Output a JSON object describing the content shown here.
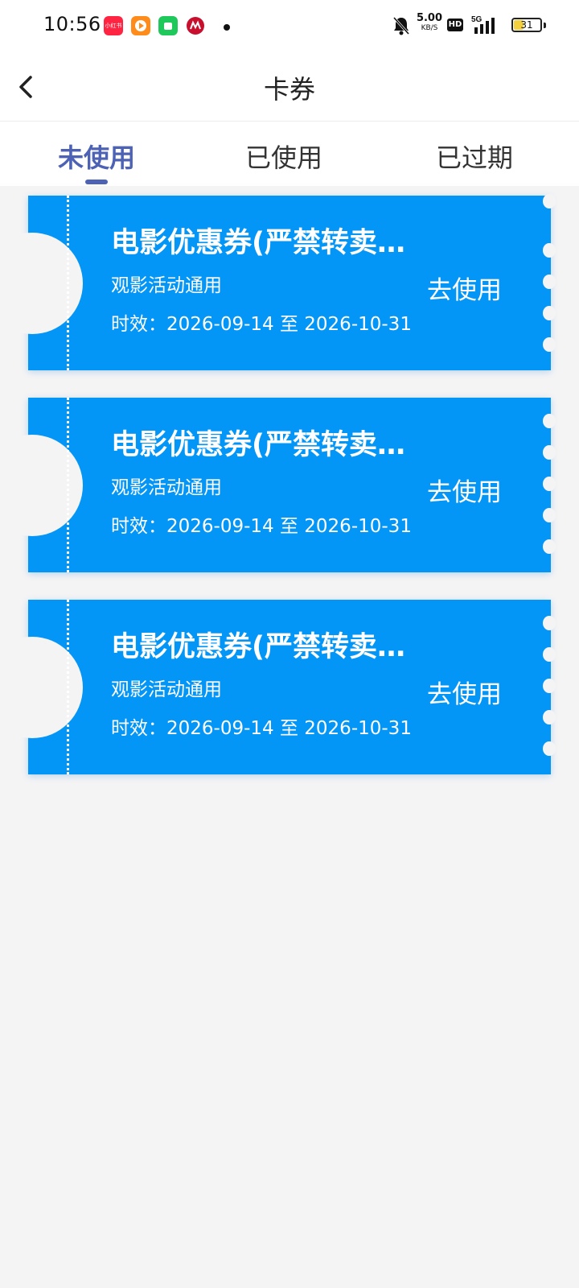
{
  "status_bar": {
    "time": "10:56",
    "speed_value": "5.00",
    "speed_unit": "KB/S",
    "hd_label": "HD",
    "network": "5G",
    "battery": "31",
    "app_icons": [
      {
        "name": "xiaohongshu-icon",
        "color": "#ff2442",
        "label": "小红书"
      },
      {
        "name": "video-app-icon",
        "color": "#ff8c1a",
        "label": ""
      },
      {
        "name": "green-app-icon",
        "color": "#1fc85a",
        "label": ""
      },
      {
        "name": "bank-app-icon",
        "color": "#c8102e",
        "label": ""
      }
    ]
  },
  "header": {
    "title": "卡券",
    "back_icon": "chevron-left-icon"
  },
  "tabs": [
    {
      "label": "未使用",
      "active": true
    },
    {
      "label": "已使用",
      "active": false
    },
    {
      "label": "已过期",
      "active": false
    }
  ],
  "coupons": [
    {
      "title": "电影优惠券(严禁转卖转...",
      "subtitle": "观影活动通用",
      "validity": "时效：2026-09-14 至 2026-10-31",
      "action": "去使用"
    },
    {
      "title": "电影优惠券(严禁转卖转...",
      "subtitle": "观影活动通用",
      "validity": "时效：2026-09-14 至 2026-10-31",
      "action": "去使用"
    },
    {
      "title": "电影优惠券(严禁转卖转...",
      "subtitle": "观影活动通用",
      "validity": "时效：2026-09-14 至 2026-10-31",
      "action": "去使用"
    }
  ],
  "colors": {
    "coupon_bg": "#0496f7",
    "active_tab": "#4d62b4",
    "page_bg": "#f4f4f5"
  }
}
